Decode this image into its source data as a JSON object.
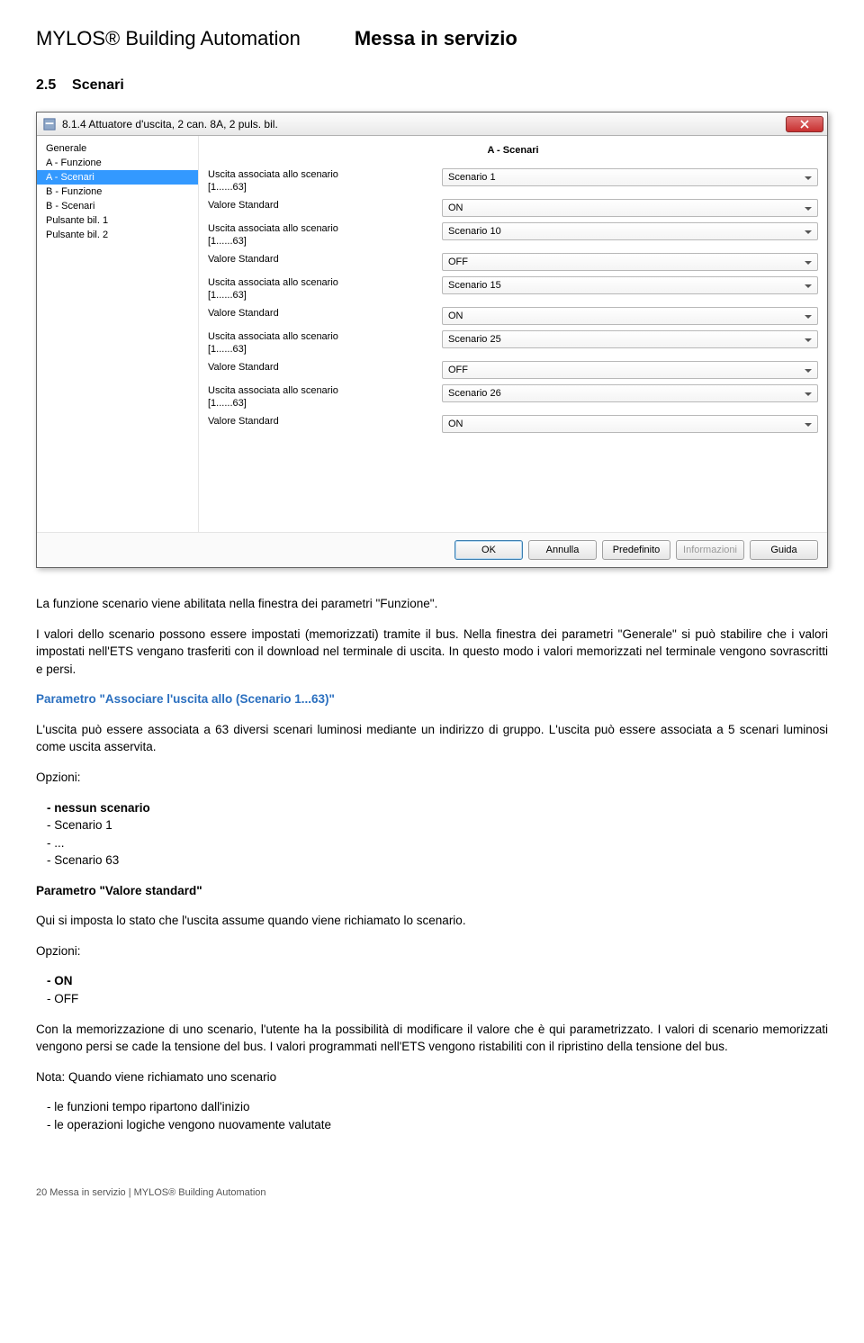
{
  "header": {
    "left": "MYLOS® Building Automation",
    "right": "Messa in servizio"
  },
  "section": {
    "number": "2.5",
    "title": "Scenari"
  },
  "dialog": {
    "title": "8.1.4 Attuatore d'uscita, 2 can. 8A, 2 puls. bil.",
    "close": "×",
    "tree": [
      {
        "label": "Generale",
        "selected": false
      },
      {
        "label": "A - Funzione",
        "selected": false
      },
      {
        "label": "A - Scenari",
        "selected": true
      },
      {
        "label": "B - Funzione",
        "selected": false
      },
      {
        "label": "B - Scenari",
        "selected": false
      },
      {
        "label": "Pulsante bil. 1",
        "selected": false
      },
      {
        "label": "Pulsante bil. 2",
        "selected": false
      }
    ],
    "panel_title": "A - Scenari",
    "params": [
      {
        "label": "Uscita associata allo scenario\n[1......63]",
        "value": "Scenario 1"
      },
      {
        "label": "Valore Standard",
        "value": "ON"
      },
      {
        "label": "Uscita associata allo scenario\n[1......63]",
        "value": "Scenario 10"
      },
      {
        "label": "Valore Standard",
        "value": "OFF"
      },
      {
        "label": "Uscita associata allo scenario\n[1......63]",
        "value": "Scenario 15"
      },
      {
        "label": "Valore Standard",
        "value": "ON"
      },
      {
        "label": "Uscita associata allo scenario\n[1......63]",
        "value": "Scenario 25"
      },
      {
        "label": "Valore Standard",
        "value": "OFF"
      },
      {
        "label": "Uscita associata allo scenario\n[1......63]",
        "value": "Scenario 26"
      },
      {
        "label": "Valore Standard",
        "value": "ON"
      }
    ],
    "buttons": {
      "ok": "OK",
      "cancel": "Annulla",
      "default_": "Predefinito",
      "info": "Informazioni",
      "help": "Guida"
    }
  },
  "body": {
    "p1": "La funzione scenario viene abilitata nella finestra dei parametri \"Funzione\".",
    "p2": "I valori dello scenario possono essere impostati (memorizzati) tramite il bus. Nella finestra dei parametri \"Generale\" si può stabilire che i valori impostati nell'ETS vengano trasferiti con il download nel terminale di uscita. In questo modo i valori memorizzati nel terminale vengono sovrascritti e persi.",
    "h1": "Parametro \"Associare l'uscita allo (Scenario 1...63)\"",
    "p3": "L'uscita può essere associata a 63 diversi scenari luminosi mediante un indirizzo di gruppo. L'uscita può essere associata a 5 scenari luminosi come uscita asservita.",
    "opts_label": "Opzioni:",
    "opts1": [
      {
        "txt": "nessun scenario",
        "bold": true
      },
      {
        "txt": "Scenario  1",
        "bold": false
      },
      {
        "txt": "...",
        "bold": false
      },
      {
        "txt": "Scenario  63",
        "bold": false
      }
    ],
    "h2": "Parametro \"Valore standard\"",
    "p4": "Qui si imposta lo stato che l'uscita assume quando viene richiamato lo scenario.",
    "opts2": [
      {
        "txt": "ON",
        "bold": true
      },
      {
        "txt": "OFF",
        "bold": false
      }
    ],
    "p5": "Con la memorizzazione di uno scenario, l'utente ha la possibilità di modificare il valore che è qui parametrizzato. I valori di scenario memorizzati vengono persi se cade la tensione del bus. I valori programmati nell'ETS vengono ristabiliti con il ripristino della tensione del bus.",
    "note_label": "Nota: Quando viene richiamato uno scenario",
    "notes": [
      "le funzioni tempo ripartono dall'inizio",
      "le operazioni logiche vengono nuovamente valutate"
    ]
  },
  "footer": "20 Messa in servizio | MYLOS® Building Automation"
}
